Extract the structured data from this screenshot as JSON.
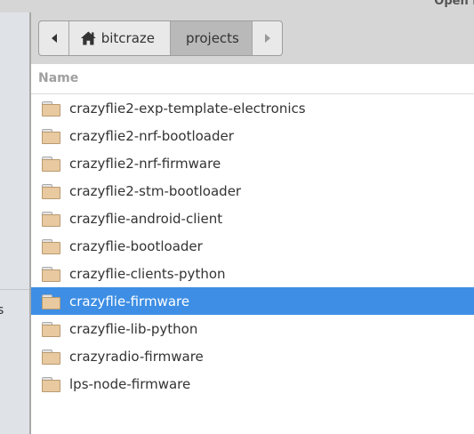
{
  "window": {
    "title": "Open Fol"
  },
  "sidebar": {
    "partial_label": "s"
  },
  "pathbar": {
    "back_icon": "left-arrow",
    "forward_icon": "right-arrow",
    "home_icon": "home-icon",
    "crumbs": [
      {
        "label": "bitcraze"
      },
      {
        "label": "projects"
      }
    ]
  },
  "list": {
    "column_header": "Name",
    "selection_color": "#3d8ee4",
    "items": [
      {
        "name": "crazyflie2-exp-template-electronics"
      },
      {
        "name": "crazyflie2-nrf-bootloader"
      },
      {
        "name": "crazyflie2-nrf-firmware"
      },
      {
        "name": "crazyflie2-stm-bootloader"
      },
      {
        "name": "crazyflie-android-client"
      },
      {
        "name": "crazyflie-bootloader"
      },
      {
        "name": "crazyflie-clients-python"
      },
      {
        "name": "crazyflie-firmware",
        "selected": true
      },
      {
        "name": "crazyflie-lib-python"
      },
      {
        "name": "crazyradio-firmware"
      },
      {
        "name": "lps-node-firmware"
      }
    ]
  }
}
